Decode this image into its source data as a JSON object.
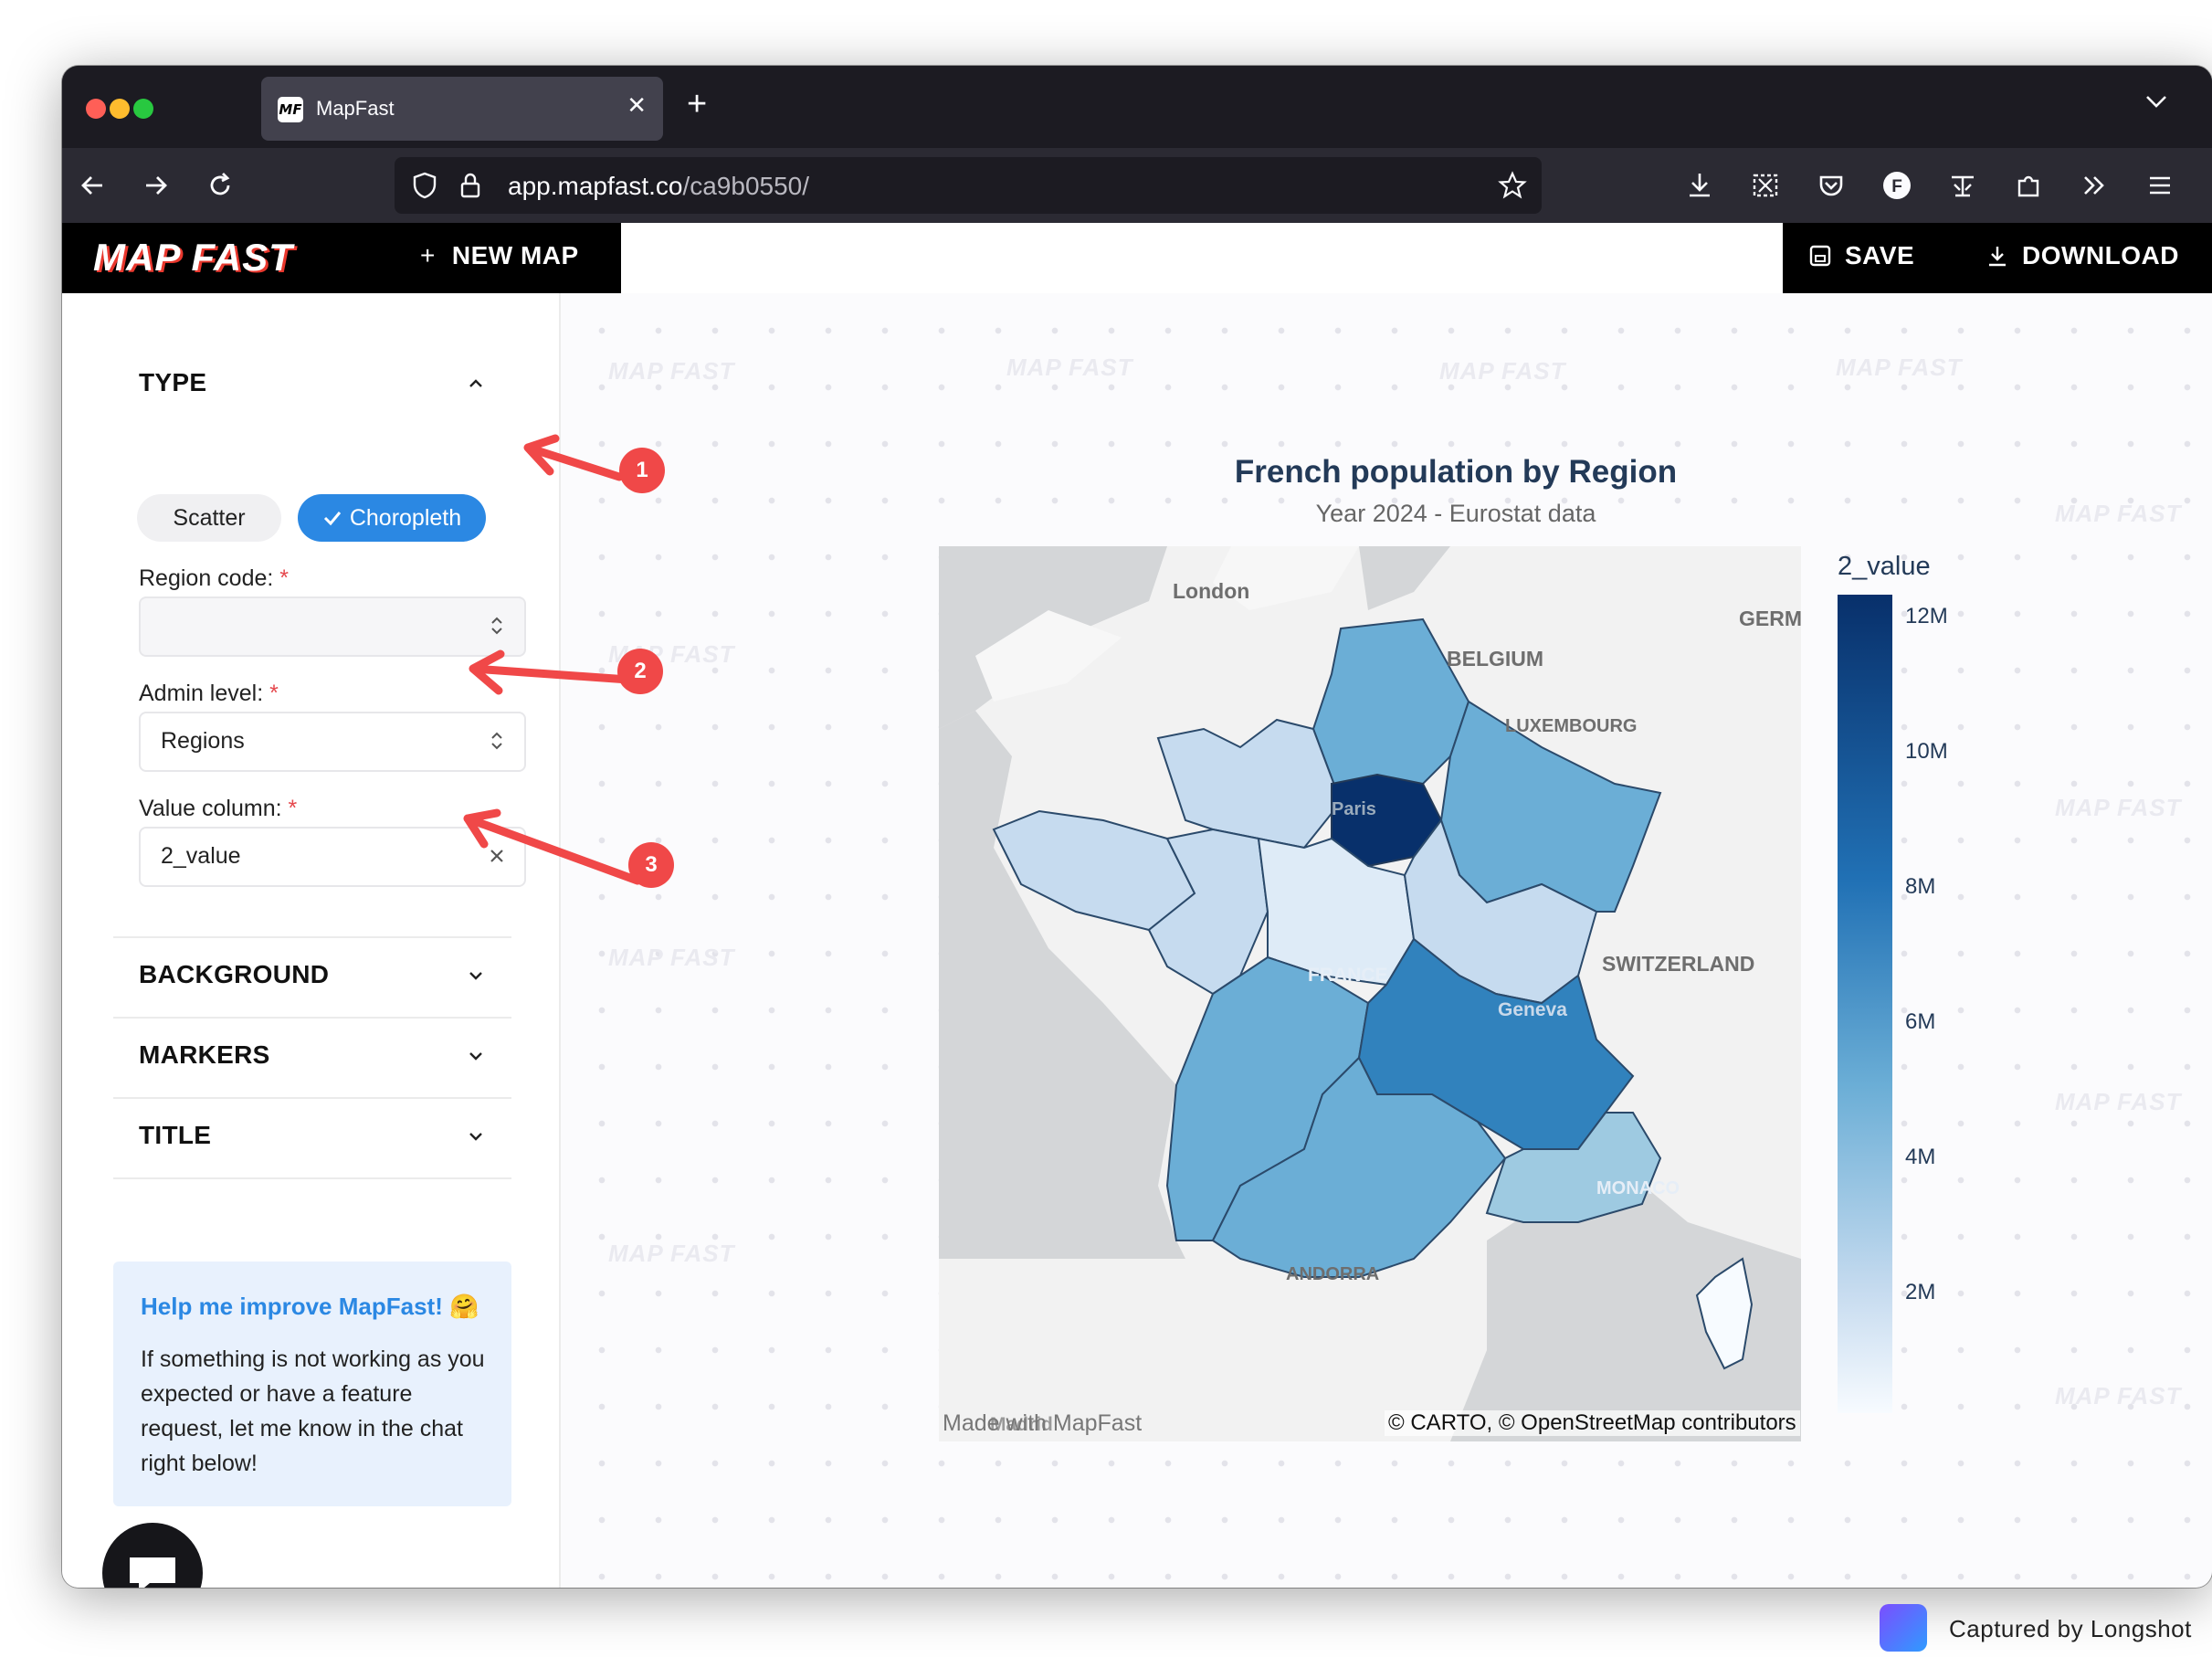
{
  "browser": {
    "tab_title": "MapFast",
    "tab_favicon": "MF",
    "url_host": "app.mapfast.co",
    "url_path": "/ca9b0550/"
  },
  "header": {
    "logo": "MAP FAST",
    "new_map": "NEW MAP",
    "save": "SAVE",
    "download": "DOWNLOAD"
  },
  "sidebar": {
    "type_title": "TYPE",
    "type_options": {
      "scatter": "Scatter",
      "choropleth": "Choropleth"
    },
    "region_code_label": "Region code:",
    "region_code_value": "",
    "admin_level_label": "Admin level:",
    "admin_level_value": "Regions",
    "value_column_label": "Value column:",
    "value_column_value": "2_value",
    "required_mark": "*",
    "sections": {
      "background": "BACKGROUND",
      "markers": "MARKERS",
      "title": "TITLE"
    },
    "help": {
      "title": "Help me improve MapFast! 🤗",
      "body": "If something is not working as you expected or have a feature request, let me know in the chat right below!"
    }
  },
  "main": {
    "watermark": "MAP FAST",
    "map_title": "French population by Region",
    "map_subtitle": "Year 2024 - Eurostat data",
    "place_labels": {
      "london": "London",
      "belgium": "BELGIUM",
      "germany": "GERM",
      "luxembourg": "LUXEMBOURG",
      "paris": "Paris",
      "france": "FRANCE",
      "switzerland": "SWITZERLAND",
      "geneva": "Geneva",
      "monaco": "MONACO",
      "andorra": "ANDORRA",
      "madrid": "Madrid"
    },
    "made_with": "Made with MapFast",
    "attribution": "© CARTO, © OpenStreetMap contributors",
    "legend": {
      "title": "2_value",
      "ticks": [
        "12M",
        "10M",
        "8M",
        "6M",
        "4M",
        "2M"
      ]
    }
  },
  "annotations": [
    "1",
    "2",
    "3"
  ],
  "capture": {
    "text": "Captured by Longshot"
  },
  "colors": {
    "accent_blue": "#2b88e3",
    "annotation_red": "#f04848",
    "choropleth_dark": "#08306b",
    "choropleth_light": "#c6dbef"
  }
}
